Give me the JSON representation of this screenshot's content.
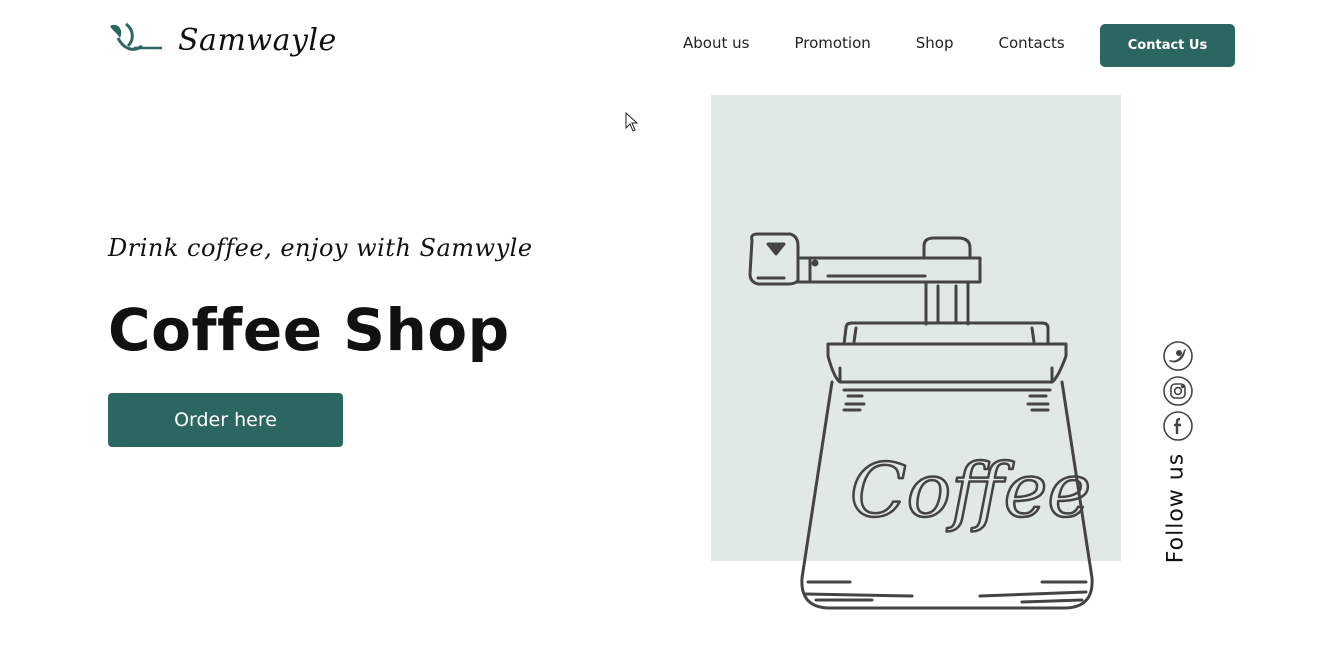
{
  "brand": {
    "name": "Samwayle",
    "accent_color": "#2c6660",
    "logo_icon": "leaf-icon"
  },
  "nav": {
    "items": [
      "About us",
      "Promotion",
      "Shop",
      "Contacts"
    ],
    "cta_label": "Contact Us"
  },
  "hero": {
    "tagline": "Drink coffee, enjoy with Samwyle",
    "title": "Coffee Shop",
    "order_label": "Order here",
    "illustration_icon": "coffee-grinder-icon",
    "illustration_text": "Coffee",
    "illustration_bg": "#e1e9e6"
  },
  "social": {
    "icons": [
      "twitter-icon",
      "instagram-icon",
      "facebook-icon"
    ],
    "follow_label": "Follow us"
  }
}
